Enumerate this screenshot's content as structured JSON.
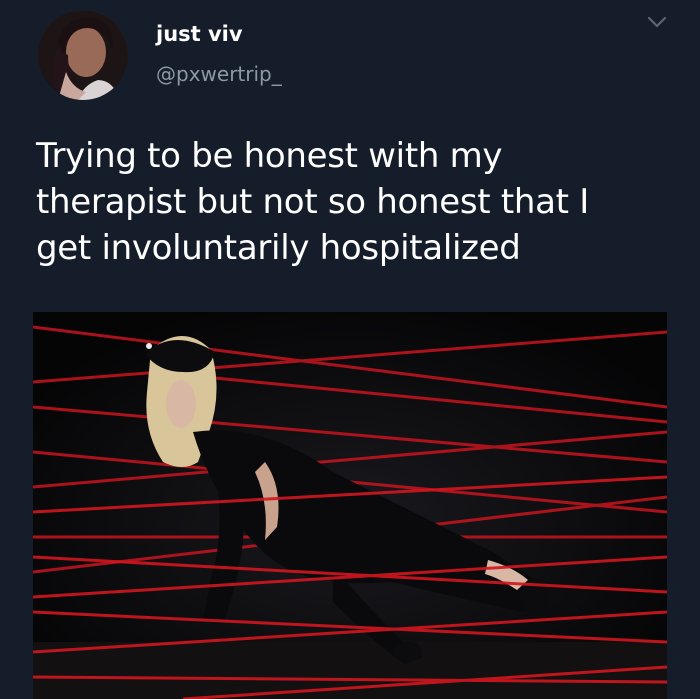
{
  "tweet": {
    "display_name": "just viv",
    "handle": "@pxwertrip_",
    "text": "Trying to be honest with my\ntherapist but not so honest that I\nget involuntarily hospitalized"
  },
  "icons": {
    "more": "chevron-down-icon",
    "avatar": "profile-photo"
  },
  "colors": {
    "background": "#141d29",
    "text_primary": "#ffffff",
    "text_secondary": "#8b98a6",
    "laser": "#c8141e"
  }
}
